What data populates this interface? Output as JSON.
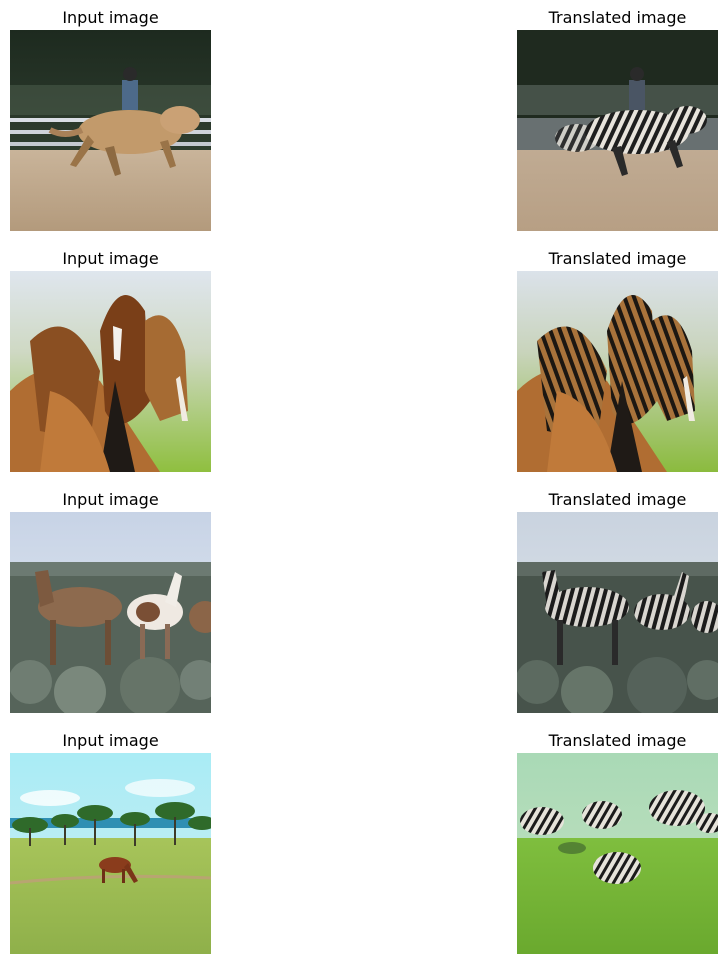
{
  "figure": {
    "rows": [
      {
        "input": {
          "title": "Input image",
          "subject": "rodeo rider on palomino horse"
        },
        "output": {
          "title": "Translated image",
          "subject": "rodeo rider on zebra-striped horse"
        }
      },
      {
        "input": {
          "title": "Input image",
          "subject": "three brown horses close-up"
        },
        "output": {
          "title": "Translated image",
          "subject": "three horses with zebra stripes close-up"
        }
      },
      {
        "input": {
          "title": "Input image",
          "subject": "two horses in sagebrush field"
        },
        "output": {
          "title": "Translated image",
          "subject": "zebra-striped horses in sagebrush field"
        }
      },
      {
        "input": {
          "title": "Input image",
          "subject": "chestnut horse grazing on meadow with trees"
        },
        "output": {
          "title": "Translated image",
          "subject": "zebra-striped trees over green meadow"
        }
      }
    ]
  },
  "colors": {
    "text": "#000000",
    "background": "#ffffff"
  }
}
